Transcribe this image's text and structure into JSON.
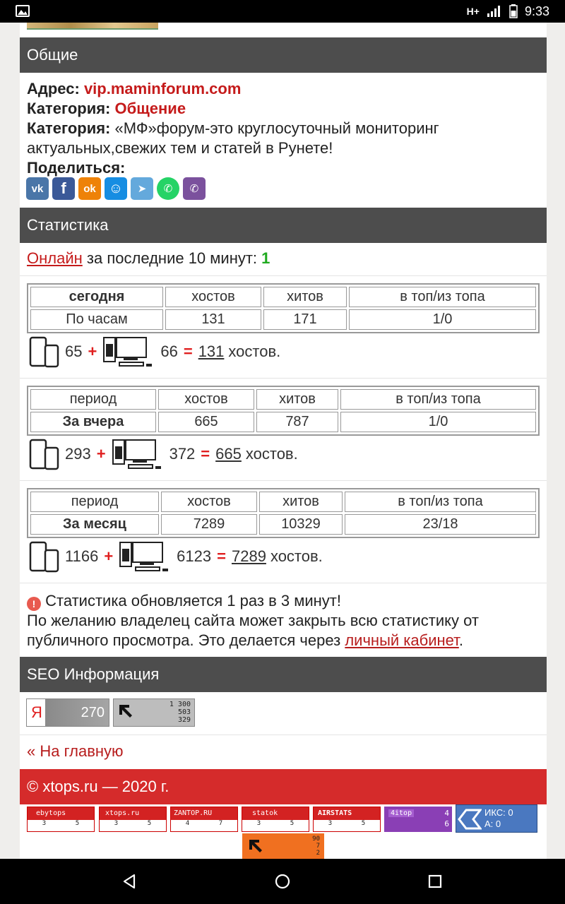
{
  "status_bar": {
    "network": "H+",
    "time": "9:33"
  },
  "general": {
    "header": "Общие",
    "address_label": "Адрес:",
    "address_value": "vip.maminforum.com",
    "category_label": "Категория:",
    "category_value": "Общение",
    "description_label": "Категория:",
    "description_line1": "«МФ»форум-это круглосуточный мониторинг",
    "description_line2": "актуальных,свежих тем и статей в Рунете!",
    "share_label": "Поделиться:",
    "share_buttons": [
      {
        "icon": "vk-icon",
        "text": "vk",
        "color": "#4a76a8"
      },
      {
        "icon": "facebook-icon",
        "text": "f",
        "color": "#3b5998"
      },
      {
        "icon": "odnoklassniki-icon",
        "text": "ok",
        "color": "#ee8208"
      },
      {
        "icon": "moimir-icon",
        "text": "☺",
        "color": "#168de2"
      },
      {
        "icon": "telegram-icon",
        "text": "➤",
        "color": "#64a9dc"
      },
      {
        "icon": "whatsapp-icon",
        "text": "✆",
        "color": "#25d366"
      },
      {
        "icon": "viber-icon",
        "text": "✆",
        "color": "#7b519d"
      }
    ]
  },
  "stats": {
    "header": "Статистика",
    "online_link": "Онлайн",
    "online_text": "за последние 10 минут:",
    "online_count": "1",
    "today": {
      "head": [
        "сегодня",
        "хостов",
        "хитов",
        "в топ/из топа"
      ],
      "row": [
        "По часам",
        "131",
        "171",
        "1/0"
      ],
      "mobile": "65",
      "desktop": "66",
      "total": "131",
      "unit": "хостов."
    },
    "yesterday": {
      "head": [
        "период",
        "хостов",
        "хитов",
        "в топ/из топа"
      ],
      "row": [
        "За вчера",
        "665",
        "787",
        "1/0"
      ],
      "mobile": "293",
      "desktop": "372",
      "total": "665",
      "unit": "хостов."
    },
    "month": {
      "head": [
        "период",
        "хостов",
        "хитов",
        "в топ/из топа"
      ],
      "row": [
        "За месяц",
        "7289",
        "10329",
        "23/18"
      ],
      "mobile": "1166",
      "desktop": "6123",
      "total": "7289",
      "unit": "хостов."
    },
    "plus": "+",
    "equals": "=",
    "note_line1": "Статистика обновляется 1 раз в 3 минут!",
    "note_line2": "По желанию владелец сайта может закрыть всю статистику от",
    "note_line3": "публичного просмотра. Это делается через",
    "cabinet_link": "личный кабинет",
    "note_end": "."
  },
  "seo": {
    "header": "SEO Информация",
    "yandex_letter": "Я",
    "yandex_value": "270",
    "li_values": [
      "1 300",
      "503",
      "329"
    ]
  },
  "home_link": "« На главную",
  "footer": "© xtops.ru — 2020 г.",
  "counters": [
    {
      "name": "ebytops",
      "a": "3",
      "b": "5"
    },
    {
      "name": "xtops.ru",
      "a": "3",
      "b": "5"
    },
    {
      "name": "ZANTOP.RU",
      "a": "4",
      "b": "7"
    },
    {
      "name": "statok",
      "a": "3",
      "b": "5"
    },
    {
      "name": "AIRSTATS",
      "a": "3",
      "b": "5"
    },
    {
      "name": "4itop",
      "a": "4",
      "b": "6"
    },
    {
      "name": "ИКС: 0",
      "a": "А: 0",
      "b": ""
    }
  ],
  "li_counter": [
    "90",
    "7",
    "2"
  ]
}
